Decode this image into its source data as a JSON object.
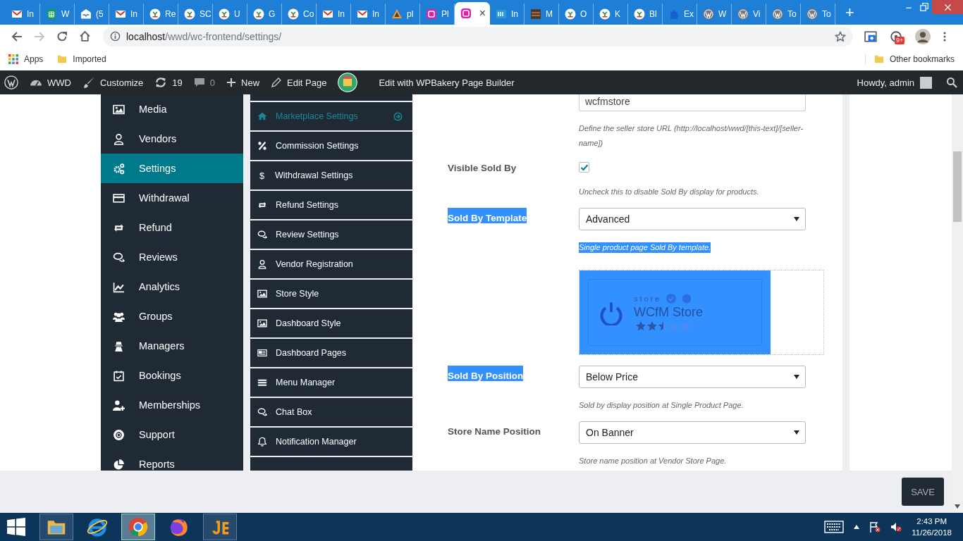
{
  "browser": {
    "tabs": [
      {
        "kind": "gmail",
        "title": "In",
        "selected": false
      },
      {
        "kind": "sheets",
        "title": "W",
        "selected": false
      },
      {
        "kind": "inbox",
        "title": "(5",
        "selected": false
      },
      {
        "kind": "gmail",
        "title": "In",
        "selected": false
      },
      {
        "kind": "wcm",
        "title": "Re",
        "selected": false
      },
      {
        "kind": "wcm",
        "title": "SC",
        "selected": false
      },
      {
        "kind": "wcm",
        "title": "U",
        "selected": false
      },
      {
        "kind": "wcm",
        "title": "G",
        "selected": false
      },
      {
        "kind": "wcm",
        "title": "Co",
        "selected": false
      },
      {
        "kind": "gmail",
        "title": "In",
        "selected": false
      },
      {
        "kind": "gmail",
        "title": "In",
        "selected": false
      },
      {
        "kind": "pm",
        "title": "pl",
        "selected": false
      },
      {
        "kind": "wcfm",
        "title": "Pl",
        "selected": false
      },
      {
        "kind": "wcfm",
        "close": "×",
        "selected": true
      },
      {
        "kind": "ibb",
        "title": "In",
        "selected": false
      },
      {
        "kind": "photo",
        "title": "M",
        "selected": false
      },
      {
        "kind": "wcm",
        "title": "O",
        "selected": false
      },
      {
        "kind": "wcm",
        "title": "K",
        "selected": false
      },
      {
        "kind": "wcm",
        "title": "Bl",
        "selected": false
      },
      {
        "kind": "puzzle",
        "title": "Ex",
        "selected": false
      },
      {
        "kind": "wp",
        "title": "W",
        "selected": false
      },
      {
        "kind": "wp",
        "title": "Vi",
        "selected": false
      },
      {
        "kind": "wp",
        "title": "To",
        "selected": false
      },
      {
        "kind": "wp",
        "title": "To",
        "selected": false
      }
    ],
    "new_tab": "+",
    "forward_disabled": true,
    "url": {
      "host": "localhost",
      "path": "/wwd/wc-frontend/settings/"
    },
    "extension_badge": "9+",
    "bookmarks": [
      {
        "kind": "apps",
        "label": "Apps"
      },
      {
        "kind": "folder",
        "label": "Imported"
      }
    ],
    "other_bookmarks": "Other bookmarks"
  },
  "admin_bar": {
    "items": [
      {
        "kind": "wp"
      },
      {
        "kind": "gauge",
        "label": "WWD"
      },
      {
        "kind": "brush",
        "label": "Customize"
      },
      {
        "kind": "refresh",
        "label": "19"
      },
      {
        "kind": "comment",
        "label": "0"
      },
      {
        "kind": "plus",
        "label": "New"
      },
      {
        "kind": "pencil",
        "label": "Edit Page"
      },
      {
        "kind": "builder"
      },
      {
        "kind": "text",
        "label": "Edit with WPBakery Page Builder"
      }
    ],
    "greeting": "Howdy, admin"
  },
  "sidebar": {
    "items": [
      {
        "kind": "image",
        "label": "Media",
        "selected": false
      },
      {
        "kind": "user",
        "label": "Vendors",
        "selected": false
      },
      {
        "kind": "gears",
        "label": "Settings",
        "selected": true
      },
      {
        "kind": "card",
        "label": "Withdrawal",
        "selected": false
      },
      {
        "kind": "arrows",
        "label": "Refund",
        "selected": false
      },
      {
        "kind": "chat",
        "label": "Reviews",
        "selected": false
      },
      {
        "kind": "chart",
        "label": "Analytics",
        "selected": false
      },
      {
        "kind": "group",
        "label": "Groups",
        "selected": false
      },
      {
        "kind": "person",
        "label": "Managers",
        "selected": false
      },
      {
        "kind": "calendar",
        "label": "Bookings",
        "selected": false
      },
      {
        "kind": "user-plus",
        "label": "Memberships",
        "selected": false
      },
      {
        "kind": "lifebuoy",
        "label": "Support",
        "selected": false
      },
      {
        "kind": "pie",
        "label": "Reports",
        "selected": false
      }
    ]
  },
  "settings_menu": {
    "items": [
      {
        "kind": "home",
        "label": "Marketplace Settings",
        "selected": true
      },
      {
        "kind": "percent",
        "label": "Commission Settings",
        "selected": false
      },
      {
        "kind": "glyph",
        "glyph": "$",
        "label": "Withdrawal Settings",
        "selected": false
      },
      {
        "kind": "arrows",
        "label": "Refund Settings",
        "selected": false
      },
      {
        "kind": "chat",
        "label": "Review Settings",
        "selected": false
      },
      {
        "kind": "user",
        "label": "Vendor Registration",
        "selected": false
      },
      {
        "kind": "image",
        "label": "Store Style",
        "selected": false
      },
      {
        "kind": "image",
        "label": "Dashboard Style",
        "selected": false
      },
      {
        "kind": "pages",
        "label": "Dashboard Pages",
        "selected": false
      },
      {
        "kind": "menu",
        "label": "Menu Manager",
        "selected": false
      },
      {
        "kind": "chat",
        "label": "Chat Box",
        "selected": false
      },
      {
        "kind": "bell",
        "label": "Notification Manager",
        "selected": false
      }
    ]
  },
  "form": {
    "rows": [
      {
        "kind": "field",
        "value": "wcfmstore"
      },
      {
        "kind": "help",
        "text": "Define the seller store URL (http://localhost/wwd/[this-text]/[seller-name])",
        "highlighted": false
      },
      {
        "kind": "checkbox",
        "label": "Visible Sold By",
        "checked": true,
        "highlighted": false
      },
      {
        "kind": "help",
        "text": "Uncheck this to disable Sold By display for products.",
        "highlighted": false
      },
      {
        "kind": "select",
        "label": "Sold By Template",
        "value": "Advanced",
        "highlighted": true
      },
      {
        "kind": "help",
        "text": "Single product page Sold By template.",
        "highlighted": true
      },
      {
        "kind": "preview",
        "caption": "store",
        "name": "WCfM Store",
        "stars": 2.5,
        "selected": true
      },
      {
        "kind": "select",
        "label": "Sold By Position",
        "value": "Below Price",
        "highlighted": true
      },
      {
        "kind": "help",
        "text": "Sold by display position at Single Product Page.",
        "highlighted": false
      },
      {
        "kind": "select",
        "label": "Store Name Position",
        "value": "On Banner",
        "highlighted": false
      },
      {
        "kind": "help",
        "text": "Store name position at Vendor Store Page.",
        "highlighted": false
      }
    ]
  },
  "save_button": "SAVE",
  "taskbar": {
    "apps": [
      {
        "kind": "folder",
        "running": true,
        "selected": false
      },
      {
        "kind": "ie",
        "running": false,
        "selected": false
      },
      {
        "kind": "chrome",
        "running": true,
        "selected": true
      },
      {
        "kind": "firefox",
        "running": false,
        "selected": false
      },
      {
        "kind": "editor",
        "running": true,
        "selected": false
      }
    ],
    "time": "2:43 PM",
    "date": "11/26/2018"
  }
}
